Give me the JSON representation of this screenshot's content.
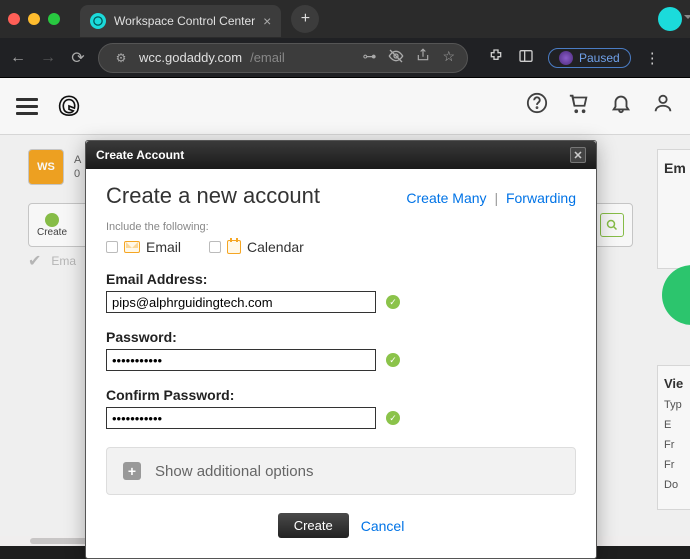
{
  "browser": {
    "tab_title": "Workspace Control Center",
    "url_host": "wcc.godaddy.com",
    "url_path": "/email",
    "paused_label": "Paused"
  },
  "page": {
    "account_line1": "A",
    "account_line2": "0",
    "account_badge": "WS",
    "create_label": "Create",
    "email_col_label": "Ema",
    "right_panel_title": "Em",
    "right_panel2_title": "Vie",
    "rp2_line1": "Typ",
    "rp2_line2": "E",
    "rp2_line3": "Fr",
    "rp2_line4": "Fr",
    "rp2_line5": "Do"
  },
  "modal": {
    "titlebar": "Create Account",
    "heading": "Create a new account",
    "link_create_many": "Create Many",
    "link_forwarding": "Forwarding",
    "include_label": "Include the following:",
    "chk_email": "Email",
    "chk_calendar": "Calendar",
    "fld_email_label": "Email Address:",
    "fld_email_value": "pips@alphrguidingtech.com",
    "fld_password_label": "Password:",
    "fld_password_value": "•••••••••••",
    "fld_confirm_label": "Confirm Password:",
    "fld_confirm_value": "•••••••••••",
    "show_more": "Show additional options",
    "btn_create": "Create",
    "btn_cancel": "Cancel"
  }
}
